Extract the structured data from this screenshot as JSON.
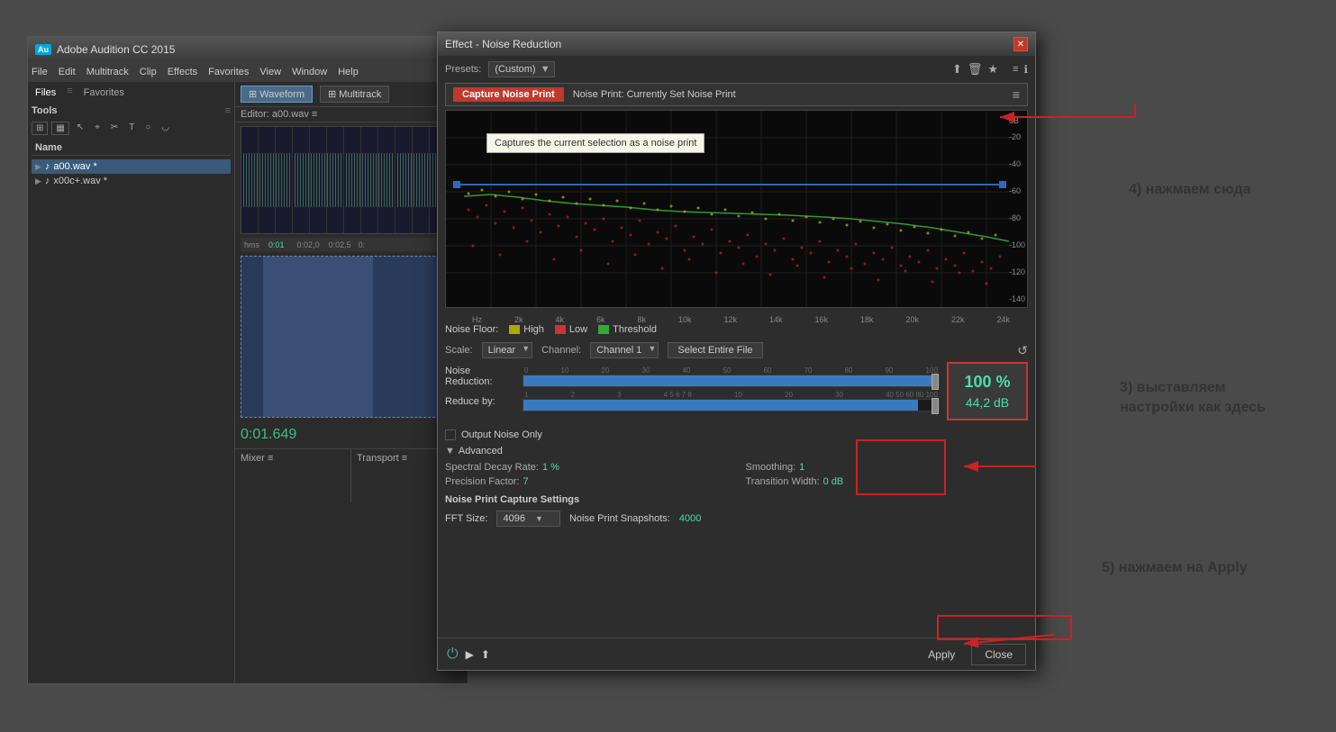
{
  "audition": {
    "title": "Adobe Audition CC 2015",
    "logo": "Au",
    "menu": [
      "File",
      "Edit",
      "Multitrack",
      "Clip",
      "Effects",
      "Favorites",
      "View",
      "Window",
      "Help"
    ],
    "sidebar": {
      "tabs": [
        "Files",
        "Favorites"
      ],
      "panel_title": "Tools",
      "files": [
        {
          "name": "a00.wav *",
          "type": "audio",
          "active": true
        },
        {
          "name": "x00c+.wav *",
          "type": "audio",
          "active": false
        }
      ],
      "name_col": "Name"
    },
    "waveform_btn": "Waveform",
    "multitrack_btn": "Multitrack",
    "editor_label": "Editor: a00.wav",
    "time_display": "0:01.649",
    "mixer_label": "Mixer",
    "transport_label": "Transport"
  },
  "dialog": {
    "title": "Effect - Noise Reduction",
    "presets_label": "Presets:",
    "presets_value": "(Custom)",
    "capture_noise_btn": "Capture Noise Print",
    "noise_print_label": "Noise Print: Currently Set Noise Print",
    "tooltip": "Captures the current selection as a noise print",
    "noise_floor_label": "Noise Floor:",
    "legend": {
      "high_color": "#aaaa00",
      "high_label": "High",
      "low_color": "#cc3333",
      "low_label": "Low",
      "threshold_color": "#33aa33",
      "threshold_label": "Threshold"
    },
    "scale_label": "Scale:",
    "scale_value": "Linear",
    "channel_label": "Channel:",
    "channel_value": "Channel 1",
    "select_entire_label": "Select Entire File",
    "noise_reduction_label": "Noise Reduction:",
    "nr_ticks": [
      "0",
      "10",
      "20",
      "30",
      "40",
      "50",
      "60",
      "70",
      "80",
      "90",
      "100"
    ],
    "reduce_by_label": "Reduce by:",
    "rb_ticks": [
      "1",
      "2",
      "3",
      "4 5 6 7 8",
      "10",
      "20",
      "30",
      "40 50 60 80 100"
    ],
    "nr_percent": "100 %",
    "nr_db": "44,2 dB",
    "output_noise_label": "Output Noise Only",
    "advanced_label": "Advanced",
    "spectral_decay_label": "Spectral Decay Rate:",
    "spectral_decay_val": "1 %",
    "smoothing_label": "Smoothing:",
    "smoothing_val": "1",
    "precision_label": "Precision Factor:",
    "precision_val": "7",
    "transition_label": "Transition Width:",
    "transition_val": "0 dB",
    "noise_print_capture_label": "Noise Print Capture Settings",
    "fft_label": "FFT Size:",
    "fft_value": "4096",
    "snapshots_label": "Noise Print Snapshots:",
    "snapshots_value": "4000",
    "apply_btn": "Apply",
    "close_btn": "Close",
    "hz_labels": [
      "Hz",
      "2k",
      "4k",
      "6k",
      "8k",
      "10k",
      "12k",
      "14k",
      "16k",
      "18k",
      "20k",
      "22k",
      "24k"
    ],
    "db_labels": [
      "-20",
      "-40",
      "-60",
      "-80",
      "-100",
      "-120",
      "-140"
    ]
  },
  "annotations": {
    "note3_text": "3) выставляем\nнастройки как здесь",
    "note4_text": "4) нажмаем сюда",
    "note5_text": "5) нажмаем на Apply"
  }
}
